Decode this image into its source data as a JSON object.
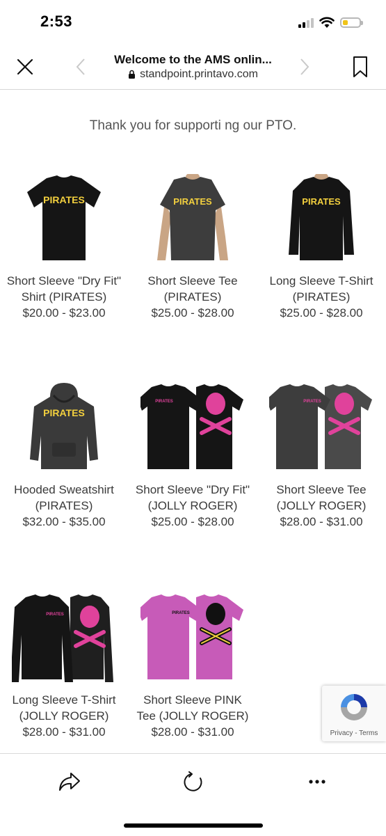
{
  "status_bar": {
    "time": "2:53",
    "battery_level": 0.3,
    "battery_color": "#f0c419"
  },
  "browser": {
    "title": "Welcome to the AMS onlin...",
    "url": "standpoint.printavo.com",
    "icons": {
      "close": "close-icon",
      "back": "chevron-left-icon",
      "forward": "chevron-right-icon",
      "bookmark": "bookmark-icon",
      "lock": "lock-icon"
    }
  },
  "page": {
    "intro": "Thank you for supporti ng our PTO.",
    "products": [
      {
        "name": "Short Sleeve \"Dry Fit\" Shirt (PIRATES)",
        "price": "$20.00 - $23.00"
      },
      {
        "name": "Short Sleeve Tee (PIRATES)",
        "price": "$25.00 - $28.00"
      },
      {
        "name": "Long Sleeve T-Shirt (PIRATES)",
        "price": "$25.00 - $28.00"
      },
      {
        "name": "Hooded Sweatshirt (PIRATES)",
        "price": "$32.00 - $35.00"
      },
      {
        "name": "Short Sleeve \"Dry Fit\" (JOLLY ROGER)",
        "price": "$25.00 - $28.00"
      },
      {
        "name": "Short Sleeve Tee (JOLLY ROGER)",
        "price": "$28.00 - $31.00"
      },
      {
        "name": "Long Sleeve T-Shirt (JOLLY ROGER)",
        "price": "$28.00 - $31.00"
      },
      {
        "name": "Short Sleeve PINK Tee (JOLLY ROGER)",
        "price": "$28.00 - $31.00"
      }
    ],
    "shirt_print_text": "PIRATES",
    "colors": {
      "black_shirt": "#151515",
      "heather_shirt": "#3d3d3d",
      "pink_shirt": "#c75bb8",
      "gold_print": "#f3d03e",
      "pink_print": "#e0429b"
    }
  },
  "recaptcha": {
    "privacy": "Privacy",
    "terms": "Terms"
  },
  "toolbar": {
    "icons": {
      "share": "share-icon",
      "reload": "reload-icon",
      "more": "more-icon"
    }
  }
}
